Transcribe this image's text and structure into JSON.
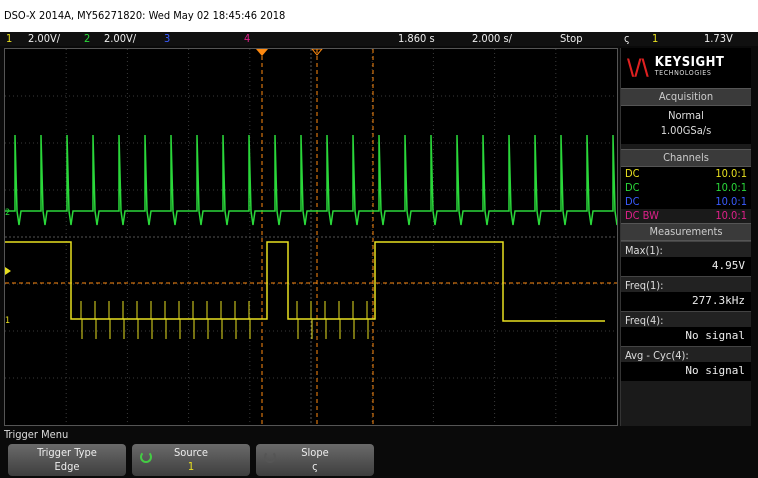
{
  "title": "DSO-X 2014A, MY56271820: Wed May 02 18:45:46 2018",
  "status": {
    "ch1_num": "1",
    "ch1_scale": "2.00V/",
    "ch2_num": "2",
    "ch2_scale": "2.00V/",
    "ch3_num": "3",
    "ch4_num": "4",
    "time_pos": "1.860 s",
    "time_scale": "2.000 s/",
    "run_state": "Stop",
    "trig_slope": "ς",
    "trig_src": "1",
    "trig_level": "1.73V"
  },
  "colors": {
    "ch1": "#e8e020",
    "ch2": "#2ad83a",
    "ch3": "#3a5cff",
    "ch4": "#e0208a",
    "trigger": "#ff8a10"
  },
  "brand": {
    "name": "KEYSIGHT",
    "sub": "TECHNOLOGIES"
  },
  "acquisition": {
    "header": "Acquisition",
    "mode": "Normal",
    "rate": "1.00GSa/s"
  },
  "channels": {
    "header": "Channels",
    "rows": [
      {
        "coupling": "DC",
        "probe": "10.0:1",
        "color": "#e8e020"
      },
      {
        "coupling": "DC",
        "probe": "10.0:1",
        "color": "#2ad83a"
      },
      {
        "coupling": "DC",
        "probe": "10.0:1",
        "color": "#3a5cff"
      },
      {
        "coupling": "DC BW",
        "probe": "10.0:1",
        "color": "#e0208a"
      }
    ]
  },
  "measurements": {
    "header": "Measurements",
    "items": [
      {
        "label": "Max(1):",
        "value": "4.95V"
      },
      {
        "label": "Freq(1):",
        "value": "277.3kHz"
      },
      {
        "label": "Freq(4):",
        "value": "No signal"
      },
      {
        "label": "Avg - Cyc(4):",
        "value": "No signal"
      }
    ]
  },
  "menu": {
    "title": "Trigger Menu",
    "keys": [
      {
        "label": "Trigger Type",
        "value": "Edge"
      },
      {
        "label": "Source",
        "value": "1"
      },
      {
        "label": "Slope",
        "value": "ς"
      }
    ]
  }
}
